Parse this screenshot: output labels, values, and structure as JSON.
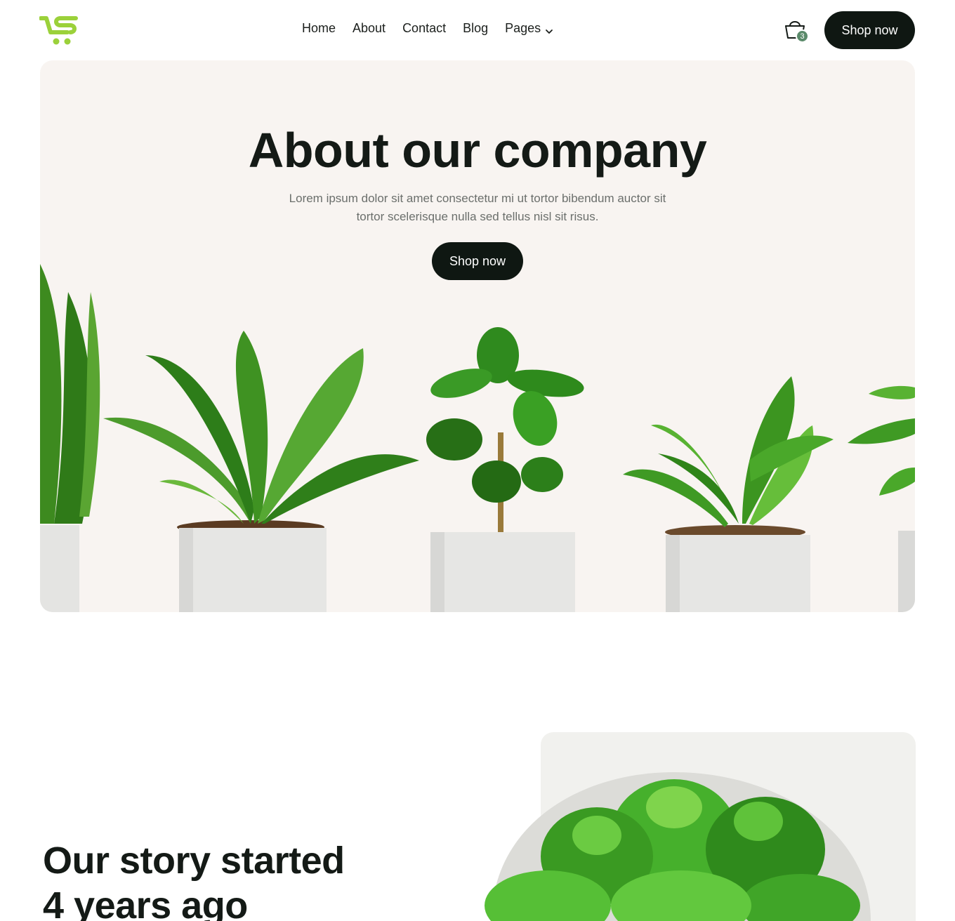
{
  "header": {
    "logo_name": "cart-logo-icon",
    "nav": [
      {
        "label": "Home"
      },
      {
        "label": "About"
      },
      {
        "label": "Contact"
      },
      {
        "label": "Blog"
      },
      {
        "label": "Pages"
      }
    ],
    "cart_count": "3",
    "shop_label": "Shop now"
  },
  "hero": {
    "title": "About our company",
    "description": "Lorem ipsum dolor sit amet consectetur mi ut tortor bibendum auctor sit tortor scelerisque nulla sed tellus nisl sit risus.",
    "shop_label": "Shop now"
  },
  "story": {
    "title_line1": "Our story started",
    "title_line2": "4 years ago"
  },
  "colors": {
    "accent": "#9bd13a",
    "dark": "#0f1712",
    "hero_bg": "#f8f4f1",
    "badge": "#5a8a6a"
  }
}
